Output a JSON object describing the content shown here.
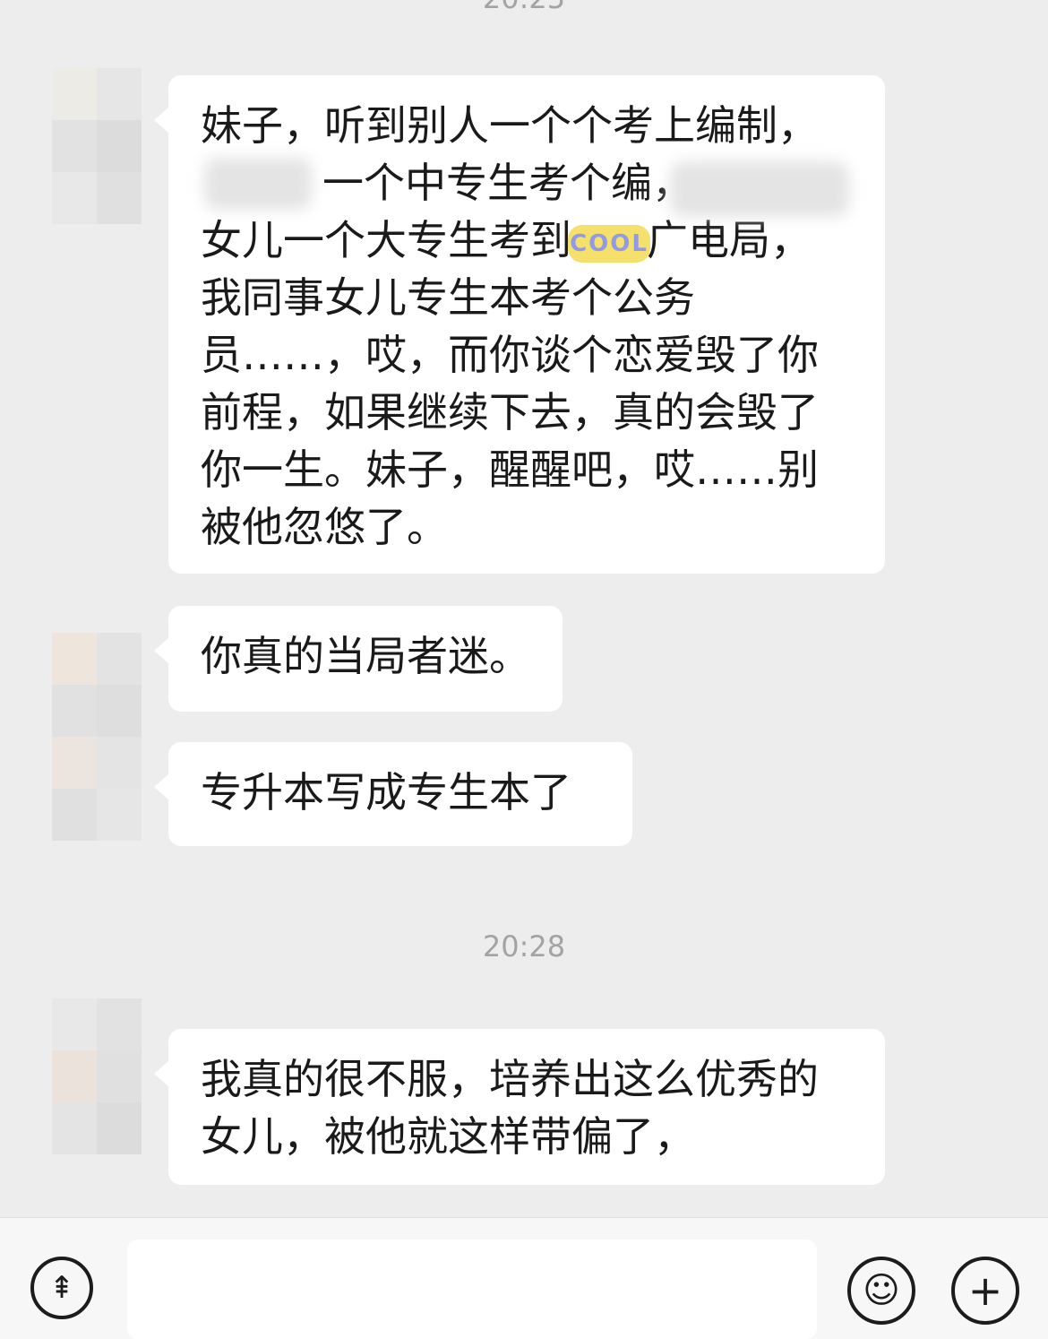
{
  "chat": {
    "timestamp_top": "20:25",
    "timestamp_mid": "20:28",
    "messages": [
      {
        "lines": [
          "妹子，听到别人一个个考上编制，",
          "一个中专生考个编，",
          "女儿一个大专生考到",
          "广电局，",
          "我同事女儿专生本考个公务",
          "员……，哎，而你谈个恋爱毁了你",
          "前程，如果继续下去，真的会毁了",
          "你一生。妹子，醒醒吧，哎……别",
          "被他忽悠了。"
        ],
        "sticker": "COOL"
      },
      {
        "lines": [
          "你真的当局者迷。"
        ]
      },
      {
        "lines": [
          "专升本写成专生本了"
        ]
      },
      {
        "lines": [
          "我真的很不服，培养出这么优秀的",
          "女儿，被他就这样带偏了，"
        ]
      }
    ]
  },
  "input_bar": {
    "voice_icon": "voice-icon",
    "text_value": "",
    "emoji_icon": "emoji-icon",
    "plus_icon": "plus-icon"
  },
  "colors": {
    "background": "#ededed",
    "bubble": "#ffffff",
    "text": "#1a1a1a",
    "timestamp": "#a3a3a3"
  },
  "watermark": ""
}
